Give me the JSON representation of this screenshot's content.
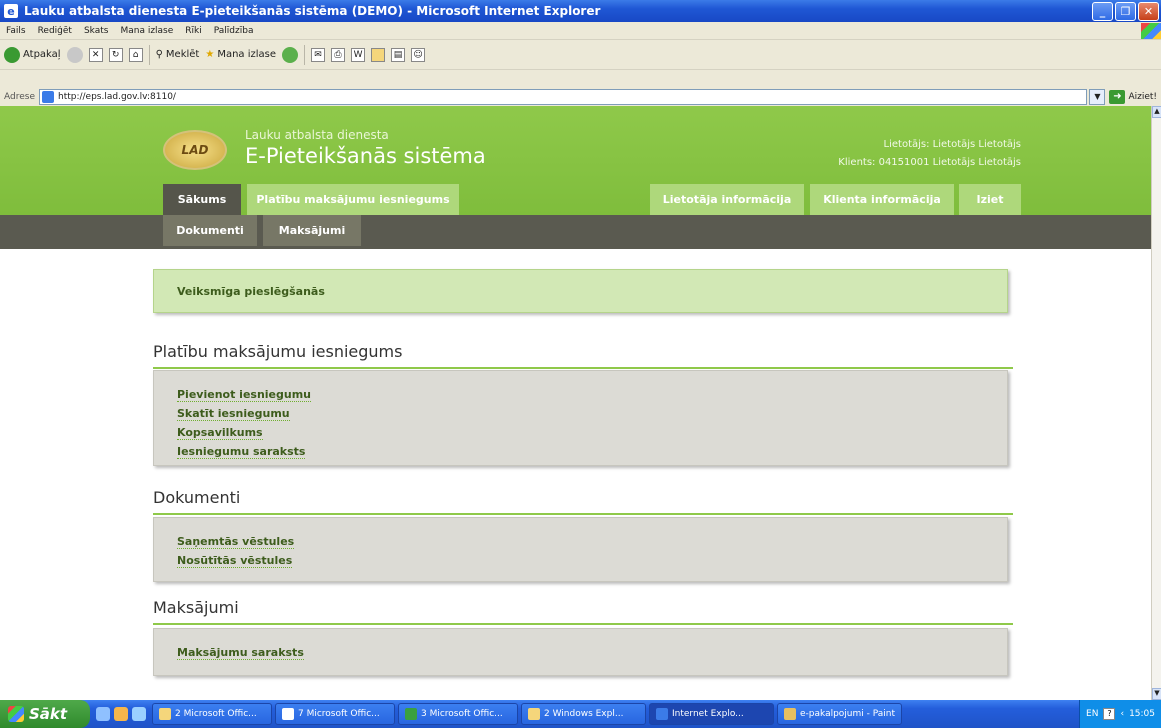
{
  "window": {
    "title": "Lauku atbalsta dienesta E-pieteikšanās sistēma (DEMO) - Microsoft Internet Explorer",
    "buttons": [
      "_",
      "❐",
      "✕"
    ]
  },
  "menubar": [
    "Fails",
    "Rediģēt",
    "Skats",
    "Mana izlase",
    "Rīki",
    "Palīdzība"
  ],
  "toolbar": {
    "back": "Atpakaļ",
    "search": "Meklēt",
    "favorites": "Mana izlase"
  },
  "address": {
    "label": "Adrese",
    "url": "http://eps.lad.gov.lv:8110/",
    "go": "Aiziet!"
  },
  "site": {
    "logo_text": "LAD",
    "brand_sub": "Lauku atbalsta dienesta",
    "brand_main": "E-Pieteikšanās sistēma",
    "user_line": "Lietotājs: Lietotājs Lietotājs",
    "client_line": "Klients: 04151001 Lietotājs Lietotājs",
    "tabs": {
      "home": "Sākums",
      "area_payments": "Platību maksājumu iesniegums",
      "user_info": "Lietotāja informācija",
      "client_info": "Klienta informācija",
      "exit": "Iziet"
    },
    "subtabs": {
      "documents": "Dokumenti",
      "payments": "Maksājumi"
    }
  },
  "main": {
    "success_message": "Veiksmīga pieslēgšanās",
    "sections": [
      {
        "title": "Platību maksājumu iesniegums",
        "links": [
          "Pievienot iesniegumu",
          "Skatīt iesniegumu",
          "Kopsavilkums",
          "Iesniegumu saraksts"
        ]
      },
      {
        "title": "Dokumenti",
        "links": [
          "Saņemtās vēstules",
          "Nosūtītās vēstules"
        ]
      },
      {
        "title": "Maksājumi",
        "links": [
          "Maksājumu saraksts"
        ]
      }
    ]
  },
  "taskbar": {
    "start": "Sākt",
    "buttons": [
      "2 Microsoft Offic...",
      "7 Microsoft Offic...",
      "3 Microsoft Offic...",
      "2 Windows Expl...",
      "Internet Explo...",
      "e-pakalpojumi - Paint"
    ],
    "lang": "EN",
    "clock": "15:05"
  }
}
